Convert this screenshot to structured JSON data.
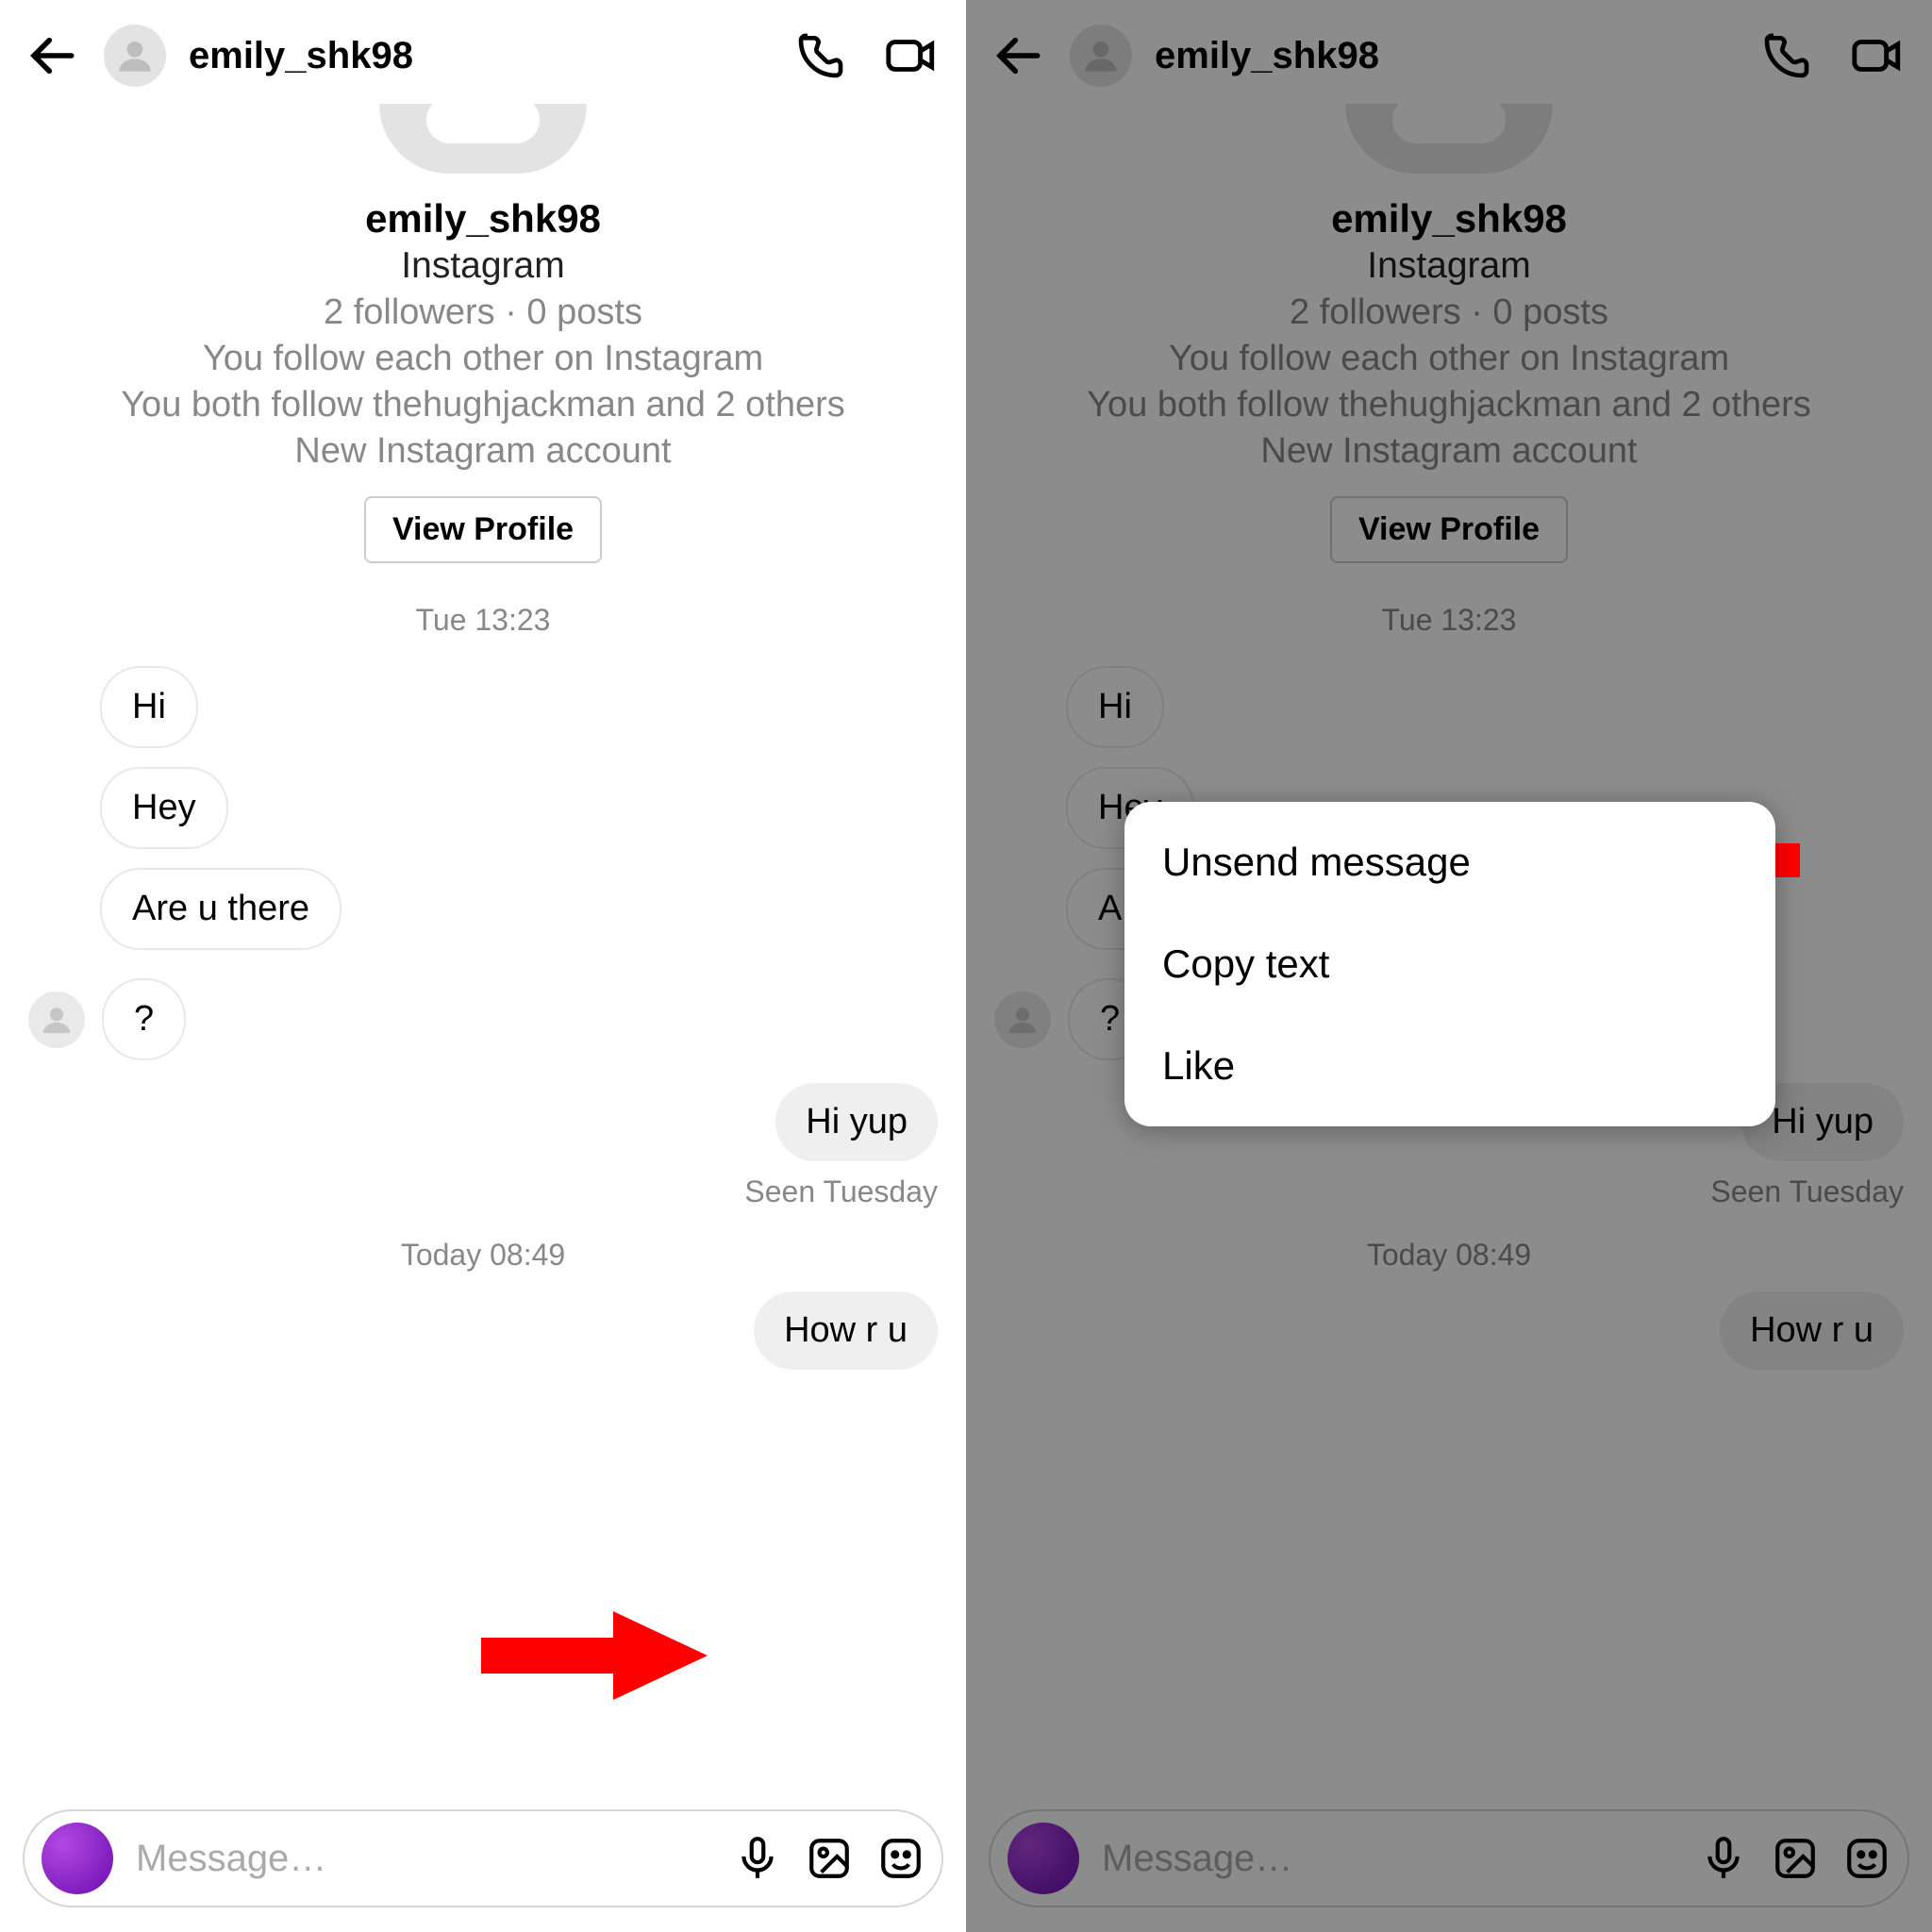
{
  "header": {
    "username": "emily_shk98"
  },
  "profile": {
    "username": "emily_shk98",
    "platform": "Instagram",
    "stats": "2 followers · 0 posts",
    "relation": "You follow each other on Instagram",
    "mutual": "You both follow thehughjackman and 2 others",
    "note": "New Instagram account",
    "view_profile_label": "View Profile"
  },
  "timestamps": {
    "first": "Tue 13:23",
    "second": "Today 08:49"
  },
  "messages": {
    "in1": "Hi",
    "in2": "Hey",
    "in3": "Are u there",
    "in4": "?",
    "out1": "Hi yup",
    "out2": "How r u",
    "seen": "Seen Tuesday"
  },
  "composer": {
    "placeholder": "Message…"
  },
  "popup": {
    "unsend": "Unsend message",
    "copy": "Copy text",
    "like": "Like"
  }
}
